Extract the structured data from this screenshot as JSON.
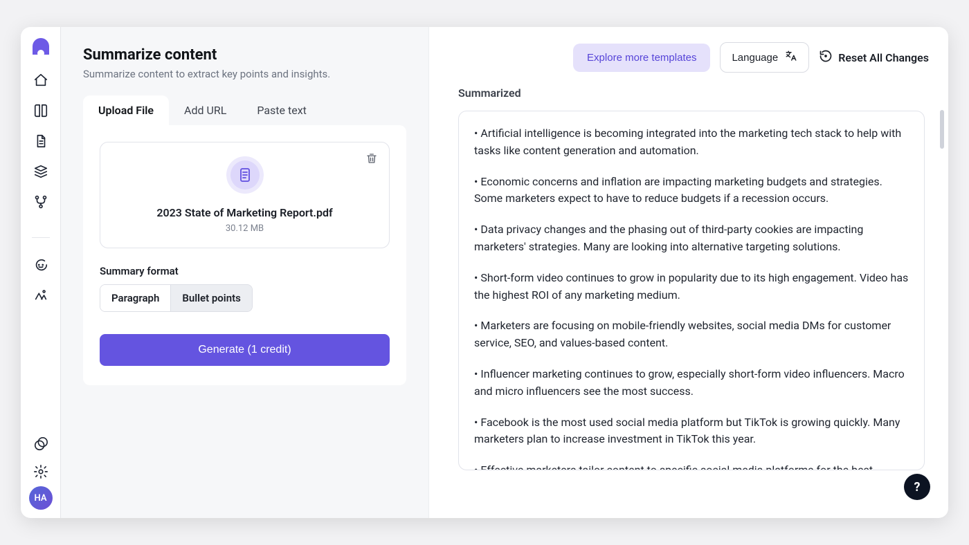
{
  "sidebar": {
    "avatar_initials": "HA"
  },
  "page": {
    "title": "Summarize content",
    "subtitle": "Summarize content to extract key points and insights."
  },
  "tabs": {
    "upload": "Upload File",
    "url": "Add URL",
    "paste": "Paste text",
    "active": "upload"
  },
  "file": {
    "name": "2023 State of Marketing Report.pdf",
    "size": "30.12 MB"
  },
  "format": {
    "label": "Summary format",
    "paragraph": "Paragraph",
    "bullets": "Bullet points",
    "active": "bullets"
  },
  "buttons": {
    "generate": "Generate (1 credit)",
    "explore": "Explore more templates",
    "language": "Language",
    "reset": "Reset All Changes"
  },
  "output": {
    "heading": "Summarized",
    "bullets": [
      "Artificial intelligence is becoming integrated into the marketing tech stack to help with tasks like content generation and automation.",
      "Economic concerns and inflation are impacting marketing budgets and strategies. Some marketers expect to have to reduce budgets if a recession occurs.",
      "Data privacy changes and the phasing out of third-party cookies are impacting marketers' strategies. Many are looking into alternative targeting solutions.",
      "Short-form video continues to grow in popularity due to its high engagement. Video has the highest ROI of any marketing medium.",
      "Marketers are focusing on mobile-friendly websites, social media DMs for customer service, SEO, and values-based content.",
      "Influencer marketing continues to grow, especially short-form video influencers. Macro and micro influencers see the most success.",
      "Facebook is the most used social media platform but TikTok is growing quickly. Many marketers plan to increase investment in TikTok this year.",
      "Effective marketers tailor content to specific social media platforms for the best results."
    ]
  },
  "help": "?"
}
